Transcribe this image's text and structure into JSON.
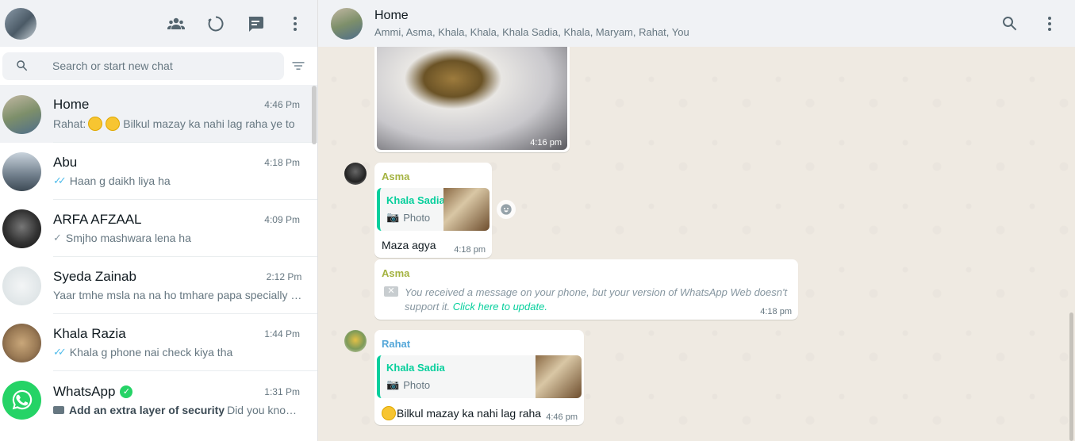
{
  "sidebar": {
    "search_placeholder": "Search or start new chat",
    "chats": [
      {
        "name": "Home",
        "time": "4:46 Pm",
        "prefix": "Rahat:",
        "preview": "Bilkul mazay ka nahi lag raha ye to",
        "color": "#a89c86"
      },
      {
        "name": "Abu",
        "time": "4:18 Pm",
        "preview": "Haan g daikh liya ha",
        "color": "#6f7d8a"
      },
      {
        "name": "ARFA AFZAAL",
        "time": "4:09 Pm",
        "preview": "Smjho mashwara lena ha",
        "color": "#3a3a3a"
      },
      {
        "name": "Syeda Zainab",
        "time": "2:12 Pm",
        "preview": "Yaar tmhe msla na na ho tmhare papa specially …",
        "color": "#dfe5e7"
      },
      {
        "name": "Khala Razia",
        "time": "1:44 Pm",
        "preview": "Khala g phone nai check kiya tha",
        "color": "#9a7a55"
      },
      {
        "name": "WhatsApp",
        "time": "1:31 Pm",
        "bold": "Add an extra layer of security",
        "preview": "Did you kno…",
        "color": "#25d366"
      }
    ]
  },
  "chat": {
    "name": "Home",
    "members": "Ammi, Asma, Khala, Khala, Khala Sadia, Khala, Maryam, Rahat, You",
    "messages": {
      "image_time": "4:16 pm",
      "m1": {
        "sender": "Asma",
        "quote_name": "Khala Sadia",
        "quote_type": "Photo",
        "text": "Maza agya",
        "time": "4:18 pm"
      },
      "m2": {
        "sender": "Asma",
        "text": "You received a message on your phone, but your version of WhatsApp Web doesn't support it.",
        "link": "Click here to update.",
        "time": "4:18 pm"
      },
      "m3": {
        "sender": "Rahat",
        "quote_name": "Khala Sadia",
        "quote_type": "Photo",
        "text": "Bilkul mazay ka nahi lag raha",
        "time": "4:46 pm"
      }
    },
    "colors": {
      "asma": "#a4b341",
      "rahat": "#53a6d8",
      "quote": "#06cf9c"
    }
  }
}
